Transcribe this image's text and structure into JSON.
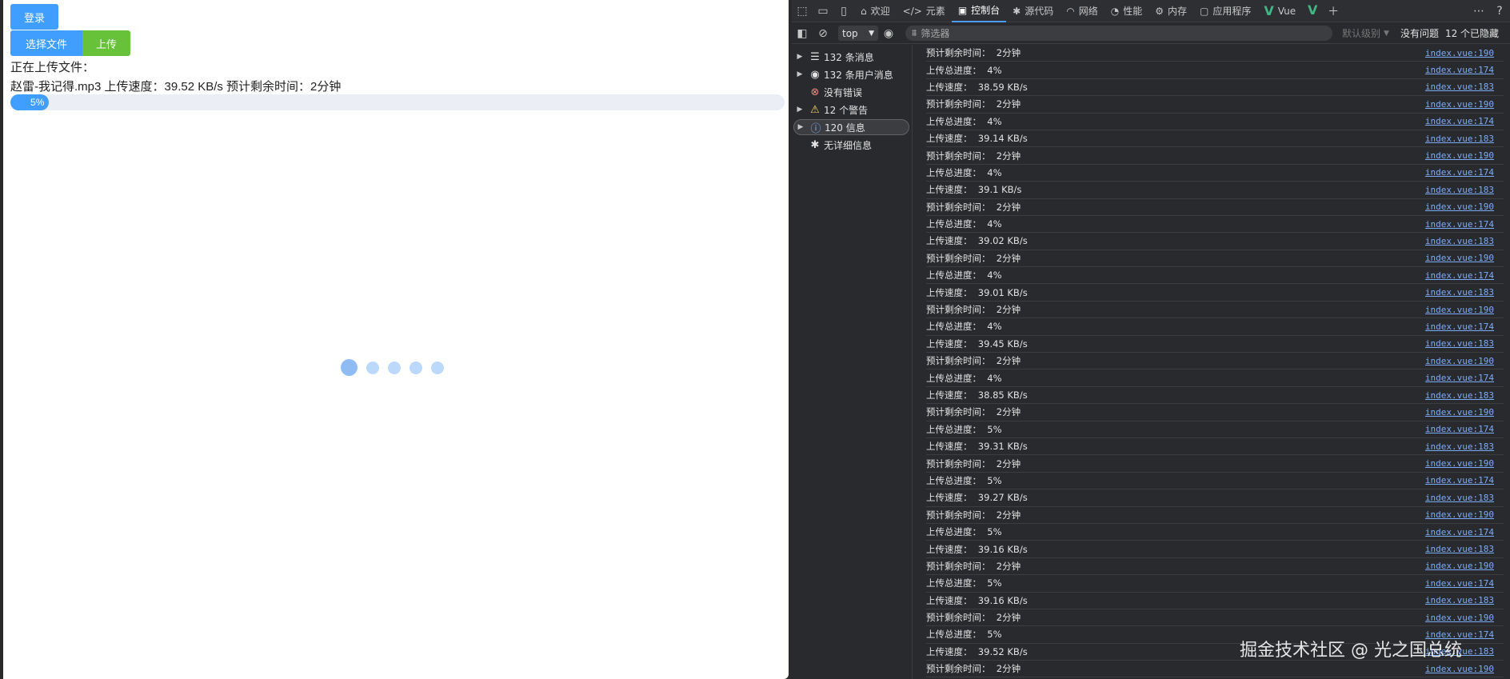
{
  "page": {
    "login_label": "登录",
    "choose_file_label": "选择文件",
    "upload_label": "上传",
    "uploading_label": "正在上传文件：",
    "upload_info": "赵雷-我记得.mp3 上传速度：39.52 KB/s 预计剩余时间：2分钟",
    "progress_percent": 5,
    "progress_text": "5%"
  },
  "devtools": {
    "tabs": [
      {
        "icon": "home-icon",
        "label": "欢迎"
      },
      {
        "icon": "code-icon",
        "label": "元素"
      },
      {
        "icon": "console-icon",
        "label": "控制台",
        "active": true
      },
      {
        "icon": "bug-icon",
        "label": "源代码"
      },
      {
        "icon": "wifi-icon",
        "label": "网络"
      },
      {
        "icon": "performance-icon",
        "label": "性能"
      },
      {
        "icon": "memory-icon",
        "label": "内存"
      },
      {
        "icon": "application-icon",
        "label": "应用程序"
      },
      {
        "icon": "vue-icon",
        "label": "Vue"
      }
    ],
    "toolbar": {
      "context": "top",
      "filter_placeholder": "筛选器",
      "level": "默认级别",
      "issues": "没有问题",
      "hidden": "12 个已隐藏"
    },
    "sidebar": [
      {
        "icon": "list-icon",
        "label": "132 条消息",
        "expandable": true
      },
      {
        "icon": "user-icon",
        "label": "132 条用户消息",
        "expandable": true
      },
      {
        "icon": "error-icon",
        "label": "没有错误",
        "expandable": false
      },
      {
        "icon": "warning-icon",
        "label": "12 个警告",
        "expandable": true
      },
      {
        "icon": "info-icon",
        "label": "120 信息",
        "expandable": true,
        "selected": true
      },
      {
        "icon": "bug-icon",
        "label": "无详细信息",
        "expandable": false
      }
    ],
    "log": [
      {
        "msg": "预计剩余时间：  2分钟",
        "src": "index.vue:190"
      },
      {
        "msg": "上传总进度：  4%",
        "src": "index.vue:174"
      },
      {
        "msg": "上传速度：  38.59 KB/s",
        "src": "index.vue:183"
      },
      {
        "msg": "预计剩余时间：  2分钟",
        "src": "index.vue:190"
      },
      {
        "msg": "上传总进度：  4%",
        "src": "index.vue:174"
      },
      {
        "msg": "上传速度：  39.14 KB/s",
        "src": "index.vue:183"
      },
      {
        "msg": "预计剩余时间：  2分钟",
        "src": "index.vue:190"
      },
      {
        "msg": "上传总进度：  4%",
        "src": "index.vue:174"
      },
      {
        "msg": "上传速度：  39.1 KB/s",
        "src": "index.vue:183"
      },
      {
        "msg": "预计剩余时间：  2分钟",
        "src": "index.vue:190"
      },
      {
        "msg": "上传总进度：  4%",
        "src": "index.vue:174"
      },
      {
        "msg": "上传速度：  39.02 KB/s",
        "src": "index.vue:183"
      },
      {
        "msg": "预计剩余时间：  2分钟",
        "src": "index.vue:190"
      },
      {
        "msg": "上传总进度：  4%",
        "src": "index.vue:174"
      },
      {
        "msg": "上传速度：  39.01 KB/s",
        "src": "index.vue:183"
      },
      {
        "msg": "预计剩余时间：  2分钟",
        "src": "index.vue:190"
      },
      {
        "msg": "上传总进度：  4%",
        "src": "index.vue:174"
      },
      {
        "msg": "上传速度：  39.45 KB/s",
        "src": "index.vue:183"
      },
      {
        "msg": "预计剩余时间：  2分钟",
        "src": "index.vue:190"
      },
      {
        "msg": "上传总进度：  4%",
        "src": "index.vue:174"
      },
      {
        "msg": "上传速度：  38.85 KB/s",
        "src": "index.vue:183"
      },
      {
        "msg": "预计剩余时间：  2分钟",
        "src": "index.vue:190"
      },
      {
        "msg": "上传总进度：  5%",
        "src": "index.vue:174"
      },
      {
        "msg": "上传速度：  39.31 KB/s",
        "src": "index.vue:183"
      },
      {
        "msg": "预计剩余时间：  2分钟",
        "src": "index.vue:190"
      },
      {
        "msg": "上传总进度：  5%",
        "src": "index.vue:174"
      },
      {
        "msg": "上传速度：  39.27 KB/s",
        "src": "index.vue:183"
      },
      {
        "msg": "预计剩余时间：  2分钟",
        "src": "index.vue:190"
      },
      {
        "msg": "上传总进度：  5%",
        "src": "index.vue:174"
      },
      {
        "msg": "上传速度：  39.16 KB/s",
        "src": "index.vue:183"
      },
      {
        "msg": "预计剩余时间：  2分钟",
        "src": "index.vue:190"
      },
      {
        "msg": "上传总进度：  5%",
        "src": "index.vue:174"
      },
      {
        "msg": "上传速度：  39.16 KB/s",
        "src": "index.vue:183"
      },
      {
        "msg": "预计剩余时间：  2分钟",
        "src": "index.vue:190"
      },
      {
        "msg": "上传总进度：  5%",
        "src": "index.vue:174"
      },
      {
        "msg": "上传速度：  39.52 KB/s",
        "src": "index.vue:183"
      },
      {
        "msg": "预计剩余时间：  2分钟",
        "src": "index.vue:190"
      }
    ]
  },
  "watermark": "掘金技术社区 @ 光之国总统"
}
